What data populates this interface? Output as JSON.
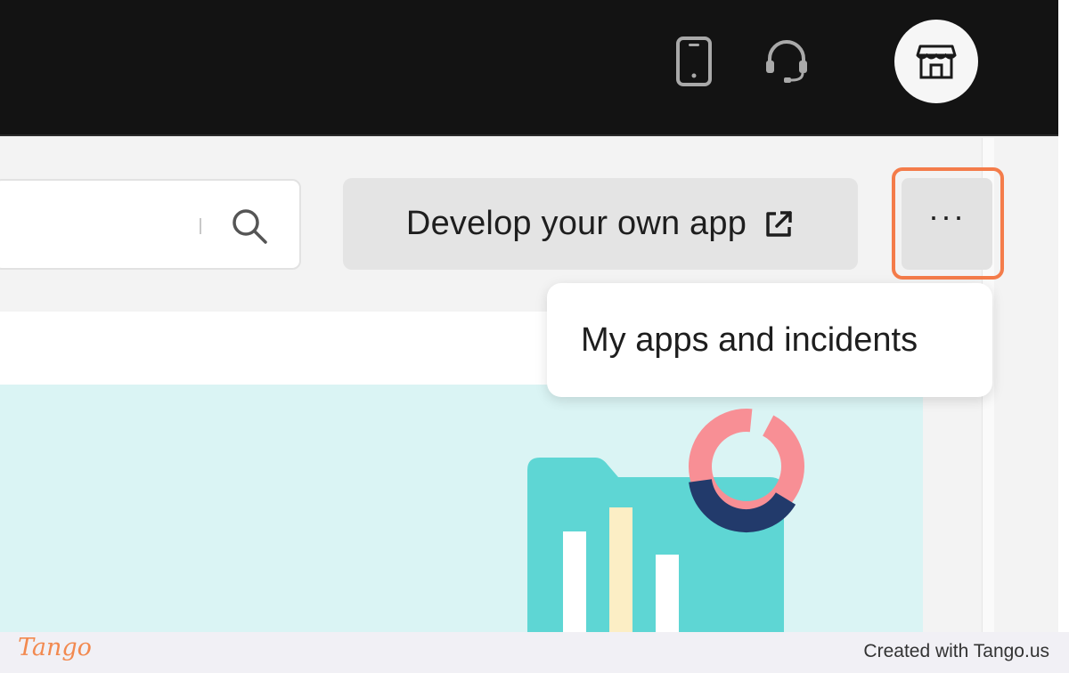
{
  "header": {
    "icons": [
      "phone-icon",
      "headset-icon",
      "store-icon"
    ],
    "colors": {
      "background": "#131313",
      "icon": "#a9a9a9"
    }
  },
  "toolbar": {
    "search": {
      "value": "",
      "placeholder": ""
    },
    "develop_button_label": "Develop your own app",
    "develop_button_icon": "external-link-icon",
    "more_button_label": "···",
    "highlight_color": "#f47c4a"
  },
  "menu": {
    "items": [
      {
        "label": "My apps and incidents"
      }
    ]
  },
  "footer": {
    "logo_text": "Tango",
    "credit": "Created with Tango.us"
  }
}
